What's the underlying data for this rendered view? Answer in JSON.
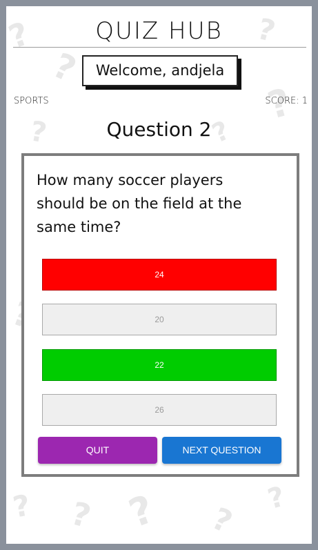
{
  "app": {
    "title": "QUIZ HUB"
  },
  "user": {
    "welcome": "Welcome, andjela"
  },
  "quiz": {
    "category": "SPORTS",
    "score": "SCORE: 1",
    "question_number": "Question 2",
    "question_text": "How many soccer players should be on the field at the same time?",
    "answers": [
      {
        "label": "24",
        "state": "wrong"
      },
      {
        "label": "20",
        "state": "neutral"
      },
      {
        "label": "22",
        "state": "correct"
      },
      {
        "label": "26",
        "state": "neutral"
      }
    ]
  },
  "buttons": {
    "quit": "QUIT",
    "next": "NEXT QUESTION"
  },
  "colors": {
    "wrong": "#ff0000",
    "correct": "#00cc00",
    "quit": "#9c27b0",
    "next": "#1976d2",
    "frame": "#8a919c"
  }
}
